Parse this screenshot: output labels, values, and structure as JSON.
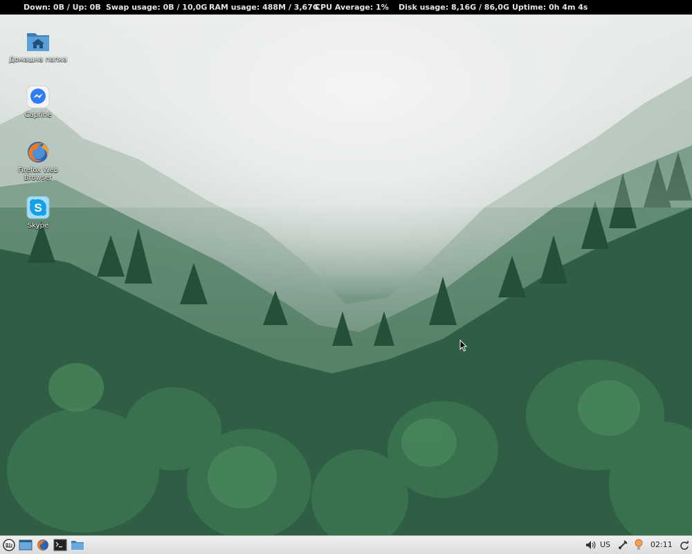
{
  "topbar": {
    "net": "Down: 0B  /  Up: 0B",
    "swap": "Swap usage: 0B  / 10,0G",
    "ram": "RAM usage: 488M  / 3,67G",
    "cpu": "CPU Average: 1%",
    "disk": "Disk usage: 8,16G  / 86,0G",
    "uptime": "Uptime: 0h 4m 4s"
  },
  "desktop": {
    "icons": [
      {
        "label": "Домашна папка",
        "icon": "home-folder-icon"
      },
      {
        "label": "Caprine",
        "icon": "caprine-messenger-icon"
      },
      {
        "label": "Firefox Web Browser",
        "icon": "firefox-icon"
      },
      {
        "label": "Skype",
        "icon": "skype-icon"
      }
    ]
  },
  "taskbar": {
    "launchers": [
      "menu-icon",
      "show-desktop-icon",
      "firefox-icon",
      "terminal-icon",
      "files-icon"
    ],
    "tray": {
      "keyboard_layout": "US",
      "clock": "02:11",
      "icons": [
        "volume-icon",
        "network-icon",
        "update-manager-icon",
        "refresh-icon"
      ]
    }
  },
  "colors": {
    "topbar_bg": "#000000",
    "topbar_text": "#e6e6e6",
    "taskbar_bg": "#e6e6e6"
  }
}
